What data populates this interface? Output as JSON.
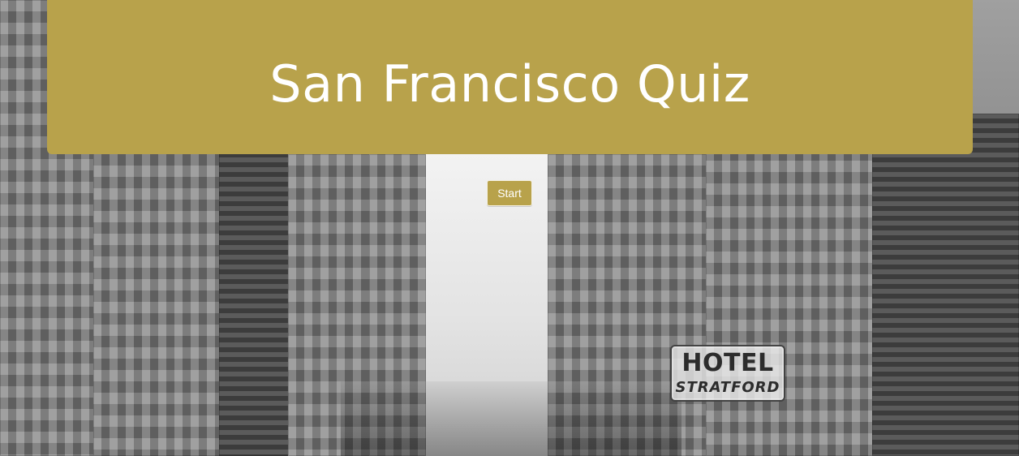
{
  "page": {
    "title": "San Francisco Quiz"
  },
  "header": {
    "bg_color": "#b8a24b",
    "text_color": "#ffffff"
  },
  "actions": {
    "start_label": "Start"
  },
  "background": {
    "signage": {
      "line1": "HOTEL",
      "line2": "STRATFORD"
    }
  }
}
